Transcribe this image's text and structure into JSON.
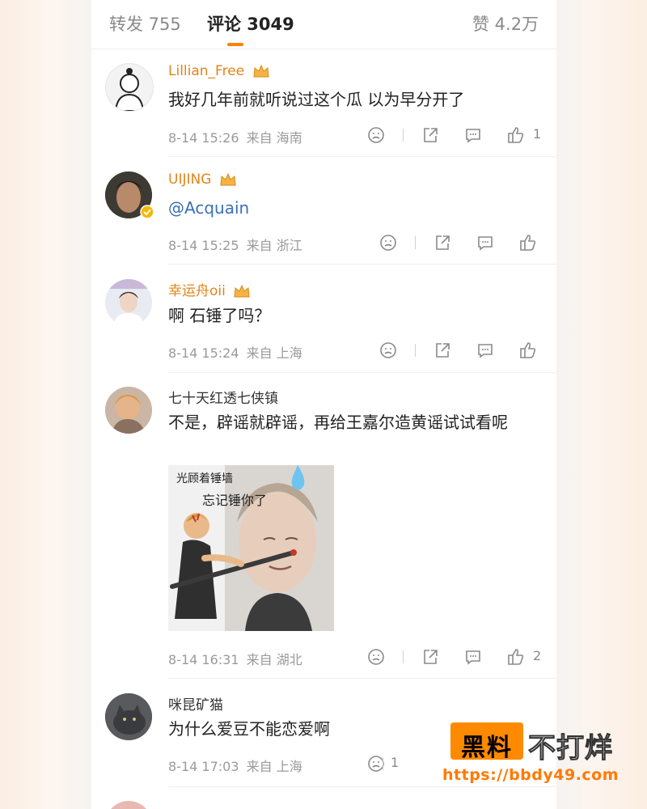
{
  "tabs": {
    "repost": "转发 755",
    "comments": "评论 3049",
    "likes": "赞 4.2万"
  },
  "comments": [
    {
      "user": "Lillian_Free",
      "text": "我好几年前就听说过这个瓜 以为早分开了",
      "time": "8-14 15:26",
      "location": "来自 海南",
      "likes": "1"
    },
    {
      "user": "UIJING",
      "text": "@Acquain",
      "time": "8-14 15:25",
      "location": "来自 浙江",
      "likes": ""
    },
    {
      "user": "幸运舟oii",
      "text": "啊 石锤了吗？",
      "time": "8-14 15:24",
      "location": "来自 上海",
      "likes": ""
    },
    {
      "user": "七十天红透七侠镇",
      "text": "不是，辟谣就辟谣，再给王嘉尔造黄谣试试看呢",
      "time": "8-14 16:31",
      "location": "来自 湖北",
      "likes": "2",
      "sticker": {
        "caption_top": "光顾着锤墙",
        "caption_main": "忘记锤你了"
      }
    },
    {
      "user": "咪昆矿猫",
      "text": "为什么爱豆不能恋爱啊",
      "time": "8-14 17:03",
      "location": "来自 上海",
      "likes": "1"
    }
  ],
  "watermark": {
    "box": "黑料",
    "side": "不打烊",
    "url": "https://bbdy49.com"
  },
  "icons": [
    "crown-icon",
    "verified-badge-icon",
    "dislike-icon",
    "share-icon",
    "comment-icon",
    "like-icon"
  ],
  "colors": {
    "accent": "#ff8200",
    "vip_name": "#e0851a",
    "mention": "#3a6fb5"
  }
}
